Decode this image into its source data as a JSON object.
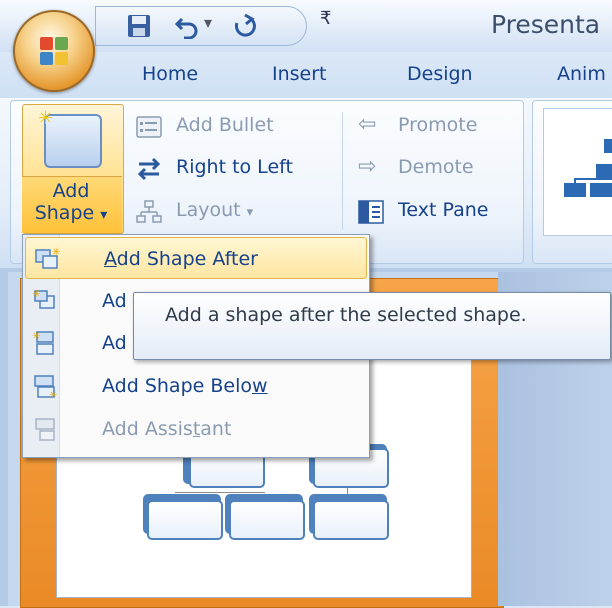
{
  "window": {
    "title": "Presenta"
  },
  "tabs": [
    {
      "label": "Home"
    },
    {
      "label": "Insert"
    },
    {
      "label": "Design"
    },
    {
      "label": "Anim"
    }
  ],
  "ribbon": {
    "add_shape": {
      "line1": "Add",
      "line2": "Shape",
      "arrow": "▾"
    },
    "add_bullet": "Add Bullet",
    "right_to_left": "Right to Left",
    "layout": "Layout",
    "layout_arrow": "▾",
    "promote": "Promote",
    "demote": "Demote",
    "text_pane": "Text Pane"
  },
  "menu": {
    "items": [
      {
        "label_pre": "",
        "access_key": "A",
        "label_post": "dd Shape After",
        "enabled": true,
        "highlighted": true
      },
      {
        "label_pre": "Ad",
        "access_key": "",
        "label_post": "",
        "enabled": true,
        "highlighted": false
      },
      {
        "label_pre": "Ad",
        "access_key": "",
        "label_post": "",
        "enabled": true,
        "highlighted": false
      },
      {
        "label_pre": "Add Shape Belo",
        "access_key": "w",
        "label_post": "",
        "enabled": true,
        "highlighted": false
      },
      {
        "label_pre": "Add Assis",
        "access_key": "t",
        "label_post": "ant",
        "enabled": false,
        "highlighted": false
      }
    ]
  },
  "tooltip": {
    "text": "Add a shape after the selected shape."
  },
  "colors": {
    "accent_text": "#15428b",
    "disabled_text": "#8a9bb1",
    "highlight": "#ffe6a1",
    "slide_selection": "#f7a54a",
    "org_box_border": "#4f81bd"
  },
  "icons": {
    "office_button": "office-logo-icon",
    "save": "save-icon",
    "undo": "undo-icon",
    "redo": "redo-icon"
  }
}
